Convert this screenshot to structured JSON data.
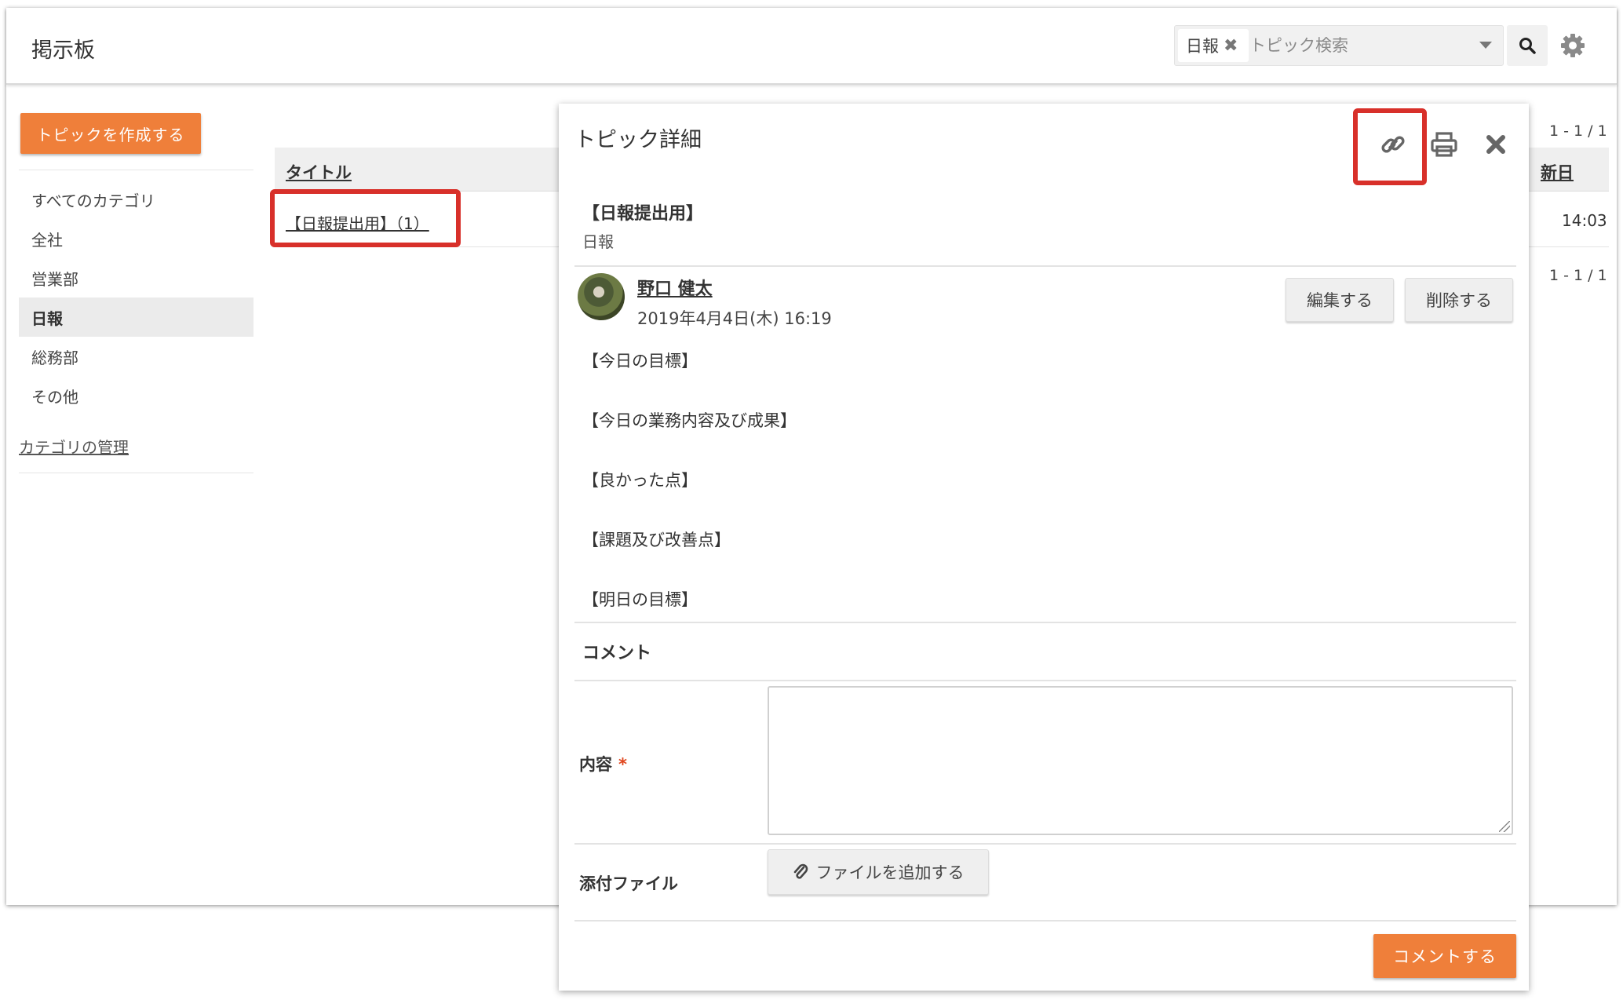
{
  "header": {
    "app_title": "掲示板",
    "filter_tag": "日報",
    "search_placeholder": "トピック検索"
  },
  "sidebar": {
    "create_button": "トピックを作成する",
    "items": [
      {
        "label": "すべてのカテゴリ",
        "active": false
      },
      {
        "label": "全社",
        "active": false
      },
      {
        "label": "営業部",
        "active": false
      },
      {
        "label": "日報",
        "active": true
      },
      {
        "label": "総務部",
        "active": false
      },
      {
        "label": "その他",
        "active": false
      }
    ],
    "manage_link": "カテゴリの管理"
  },
  "topic_list": {
    "col_title": "タイトル",
    "col_date": "新日",
    "pager_top": "1 - 1 / 1",
    "pager_bottom": "1 - 1 / 1",
    "rows": [
      {
        "title": "【日報提出用】（1）",
        "time": "14:03"
      }
    ]
  },
  "detail": {
    "panel_title": "トピック詳細",
    "icons": [
      "link-icon",
      "print-icon",
      "close-icon"
    ],
    "topic_title": "【日報提出用】",
    "category": "日報",
    "author": "野口 健太",
    "posted_at": "2019年4月4日(木) 16:19",
    "edit_button": "編集する",
    "delete_button": "削除する",
    "body_lines": [
      "【今日の目標】",
      "【今日の業務内容及び成果】",
      "【良かった点】",
      "【課題及び改善点】",
      "【明日の目標】"
    ],
    "comments_title": "コメント",
    "content_label": "内容",
    "required_mark": "*",
    "attach_label": "添付ファイル",
    "attach_button": "ファイルを追加する",
    "submit_button": "コメントする"
  },
  "colors": {
    "accent": "#ef7f3a",
    "highlight": "#d8302a"
  }
}
